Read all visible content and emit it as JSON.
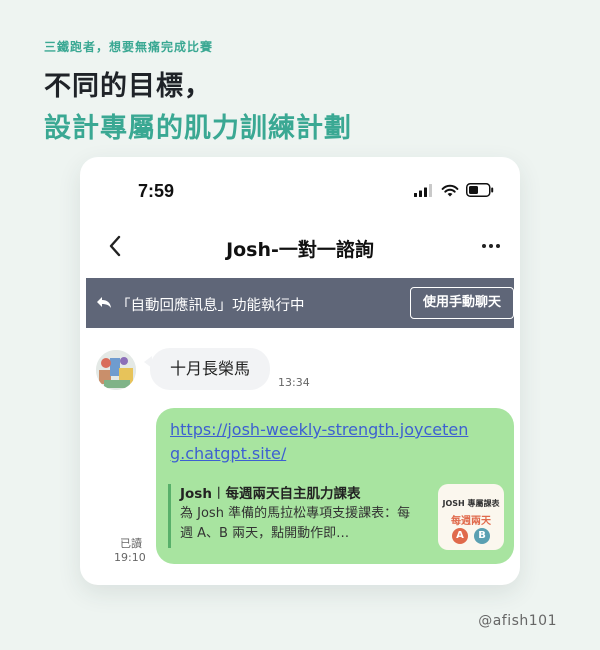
{
  "header": {
    "eyebrow": "三鐵跑者，想要無痛完成比賽",
    "title_line1": "不同的目標，",
    "title_line2": "設計專屬的肌力訓練計劃"
  },
  "status_bar": {
    "time": "7:59",
    "icons": [
      "signal-icon",
      "wifi-icon",
      "battery-icon"
    ]
  },
  "chat": {
    "title": "Josh-一對一諮詢",
    "back_icon": "chevron-left-icon",
    "more_icon": "more-horizontal-icon"
  },
  "banner": {
    "icon": "reply-icon",
    "text": "「自動回應訊息」功能執行中",
    "button_label": "使用手動聊天"
  },
  "messages": {
    "incoming": {
      "text": "十月長榮馬",
      "time": "13:34"
    },
    "outgoing": {
      "link": "https://josh-weekly-strength.joyceteng.chatgpt.site/",
      "preview_title": "Josh︱每週兩天自主肌力課表",
      "preview_desc": "為 Josh 準備的馬拉松專項支援課表：每週 A、B 兩天，點開動作即…",
      "thumb_line1": "JOSH 專屬課表",
      "thumb_line2": "每週兩天",
      "thumb_a": "A",
      "thumb_b": "B",
      "read": "已讀",
      "time": "19:10"
    }
  },
  "footer": {
    "handle": "@afish101"
  },
  "colors": {
    "accent": "#3aa893",
    "banner": "#5f6678",
    "outgoing_bubble": "#a8e4a0",
    "link": "#3d5fd1"
  }
}
